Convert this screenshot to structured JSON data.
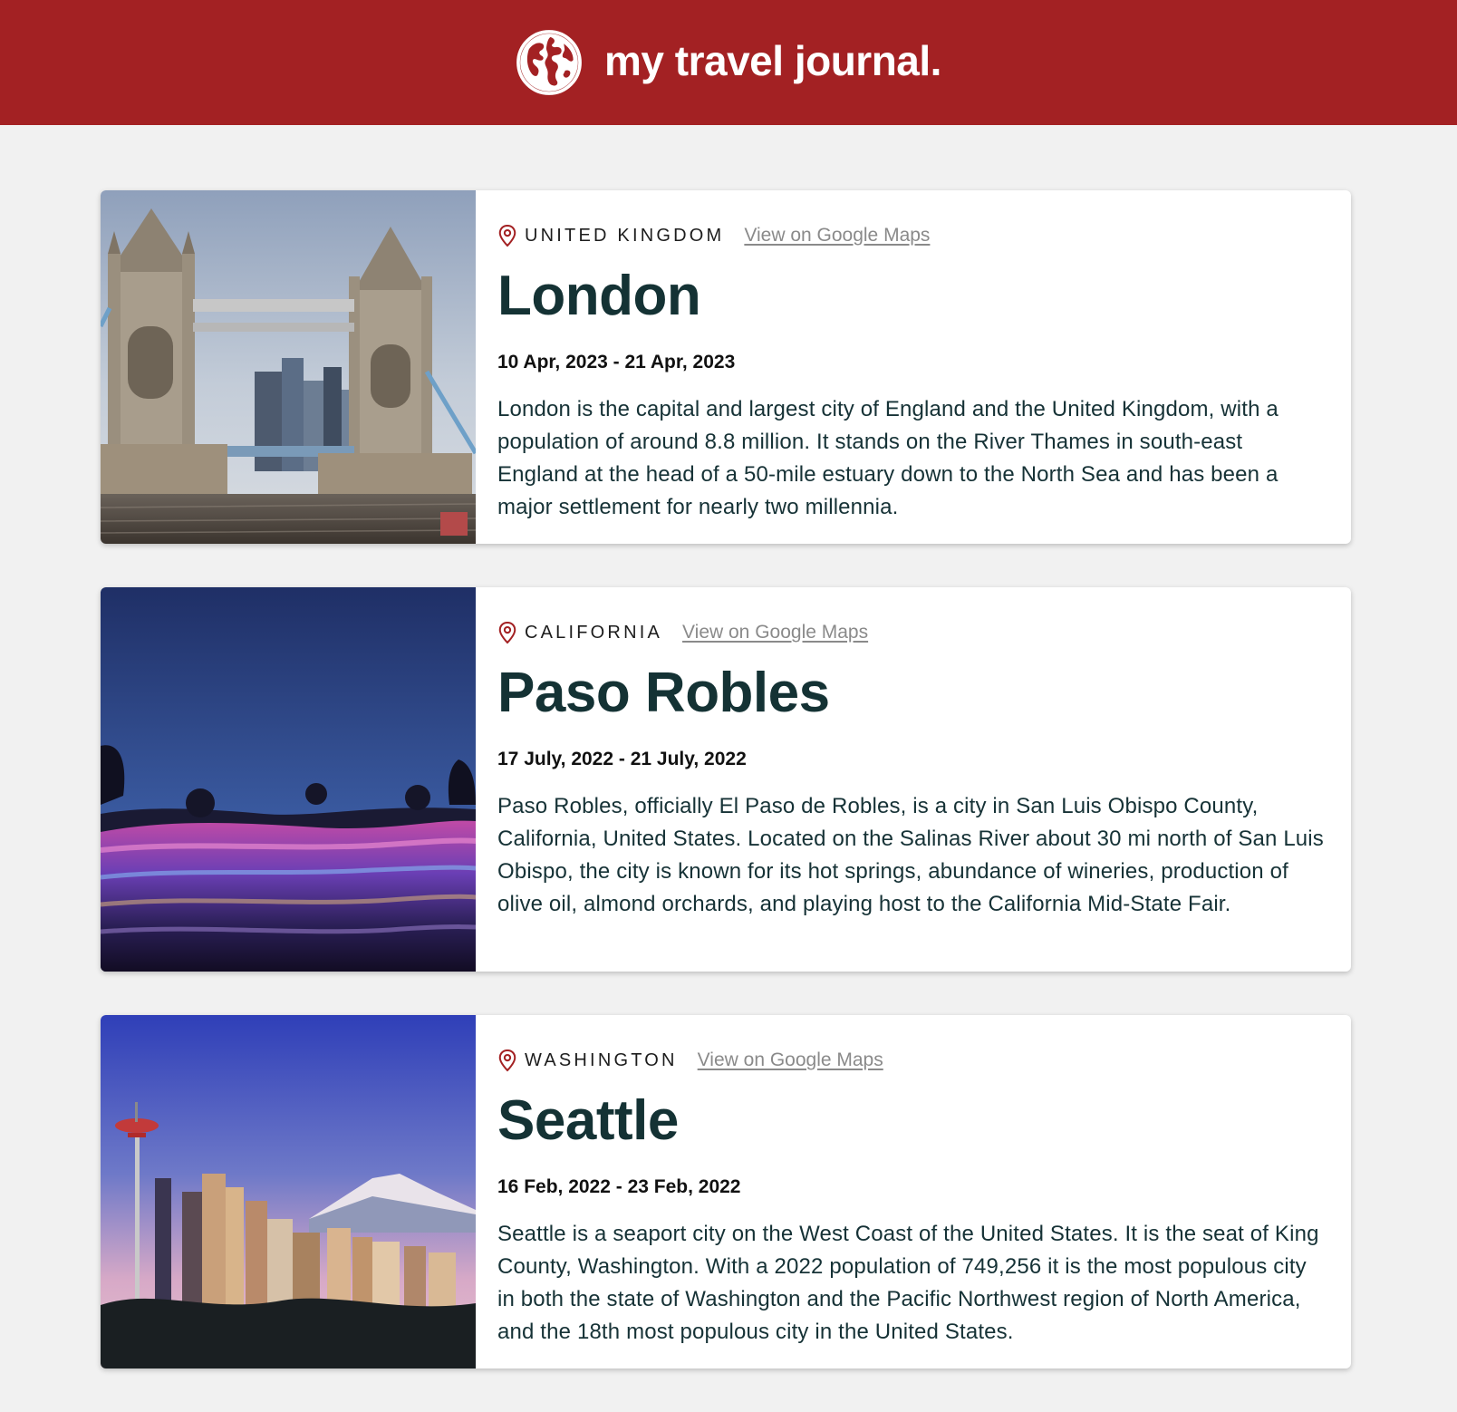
{
  "header": {
    "title": "my travel journal."
  },
  "entries": [
    {
      "country": "UNITED KINGDOM",
      "maps_label": "View on Google Maps",
      "city": "London",
      "dates": "10 Apr, 2023 - 21 Apr, 2023",
      "description": "London is the capital and largest city of England and the United Kingdom, with a population of around 8.8 million. It stands on the River Thames in south-east England at the head of a 50-mile estuary down to the North Sea and has been a major settlement for nearly two millennia."
    },
    {
      "country": "CALIFORNIA",
      "maps_label": "View on Google Maps",
      "city": "Paso Robles",
      "dates": "17 July, 2022 - 21 July, 2022",
      "description": "Paso Robles, officially El Paso de Robles, is a city in San Luis Obispo County, California, United States. Located on the Salinas River about 30 mi north of San Luis Obispo, the city is known for its hot springs, abundance of wineries, production of olive oil, almond orchards, and playing host to the California Mid-State Fair."
    },
    {
      "country": "WASHINGTON",
      "maps_label": "View on Google Maps",
      "city": "Seattle",
      "dates": "16 Feb, 2022 - 23 Feb, 2022",
      "description": "Seattle is a seaport city on the West Coast of the United States. It is the seat of King County, Washington. With a 2022 population of 749,256 it is the most populous city in both the state of Washington and the Pacific Northwest region of North America, and the 18th most populous city in the United States."
    }
  ],
  "colors": {
    "header_bg": "#a32123",
    "page_bg": "#f1f1f1",
    "city_text": "#143234",
    "pin_icon": "#a32123",
    "link_text": "#8a8a8a"
  }
}
